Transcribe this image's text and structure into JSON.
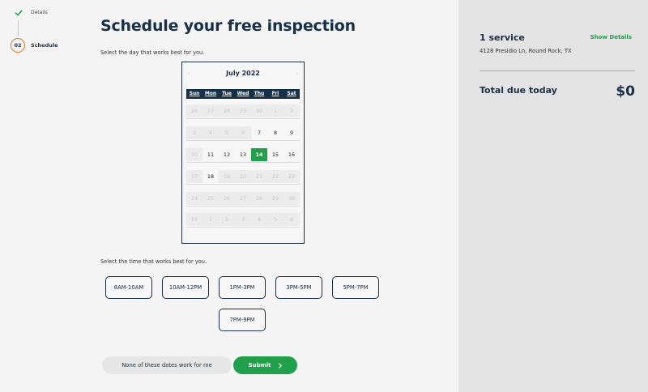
{
  "stepper": {
    "step1": {
      "label": "Details",
      "status": "complete"
    },
    "step2": {
      "number": "02",
      "label": "Schedule",
      "status": "current"
    }
  },
  "main": {
    "title": "Schedule your free inspection",
    "day_prompt": "Select the day that works best for you.",
    "time_prompt": "Select the time that works best for you."
  },
  "calendar": {
    "month_title": "July 2022",
    "prev_icon": "‹",
    "next_icon": "›",
    "weekdays": [
      "Sun",
      "Mon",
      "Tue",
      "Wed",
      "Thu",
      "Fri",
      "Sat"
    ],
    "selected_day": "14",
    "weeks": [
      [
        {
          "d": "26",
          "s": "disabled"
        },
        {
          "d": "27",
          "s": "disabled"
        },
        {
          "d": "28",
          "s": "disabled"
        },
        {
          "d": "29",
          "s": "disabled"
        },
        {
          "d": "30",
          "s": "disabled"
        },
        {
          "d": "1",
          "s": "disabled"
        },
        {
          "d": "2",
          "s": "disabled"
        }
      ],
      [
        {
          "d": "3",
          "s": "disabled"
        },
        {
          "d": "4",
          "s": "disabled"
        },
        {
          "d": "5",
          "s": "disabled"
        },
        {
          "d": "6",
          "s": "disabled"
        },
        {
          "d": "7",
          "s": "available"
        },
        {
          "d": "8",
          "s": "available"
        },
        {
          "d": "9",
          "s": "available"
        }
      ],
      [
        {
          "d": "10",
          "s": "disabled"
        },
        {
          "d": "11",
          "s": "available"
        },
        {
          "d": "12",
          "s": "available"
        },
        {
          "d": "13",
          "s": "available"
        },
        {
          "d": "14",
          "s": "selected"
        },
        {
          "d": "15",
          "s": "available"
        },
        {
          "d": "16",
          "s": "available"
        }
      ],
      [
        {
          "d": "17",
          "s": "disabled"
        },
        {
          "d": "18",
          "s": "available"
        },
        {
          "d": "19",
          "s": "disabled"
        },
        {
          "d": "20",
          "s": "disabled"
        },
        {
          "d": "21",
          "s": "disabled"
        },
        {
          "d": "22",
          "s": "disabled"
        },
        {
          "d": "23",
          "s": "disabled"
        }
      ],
      [
        {
          "d": "24",
          "s": "disabled"
        },
        {
          "d": "25",
          "s": "disabled"
        },
        {
          "d": "26",
          "s": "disabled"
        },
        {
          "d": "27",
          "s": "disabled"
        },
        {
          "d": "28",
          "s": "disabled"
        },
        {
          "d": "29",
          "s": "disabled"
        },
        {
          "d": "30",
          "s": "disabled"
        }
      ],
      [
        {
          "d": "31",
          "s": "disabled"
        },
        {
          "d": "1",
          "s": "disabled"
        },
        {
          "d": "2",
          "s": "disabled"
        },
        {
          "d": "3",
          "s": "disabled"
        },
        {
          "d": "4",
          "s": "disabled"
        },
        {
          "d": "5",
          "s": "disabled"
        },
        {
          "d": "6",
          "s": "disabled"
        }
      ]
    ]
  },
  "time_slots": [
    "8AM-10AM",
    "10AM-12PM",
    "1PM-3PM",
    "3PM-5PM",
    "5PM-7PM",
    "7PM-9PM"
  ],
  "actions": {
    "none_work_label": "None of these dates work for me",
    "submit_label": "Submit"
  },
  "summary": {
    "service_count": "1 service",
    "show_details_label": "Show Details",
    "address": "4128 Presidio Ln, Round Rock, TX",
    "total_label": "Total due today",
    "total_amount": "$0"
  },
  "colors": {
    "navy": "#14304a",
    "accent_green": "#21a04b",
    "step_orange": "#e0782a",
    "panel_gray": "#e3e3e3",
    "page_bg": "#f4f4f4"
  }
}
